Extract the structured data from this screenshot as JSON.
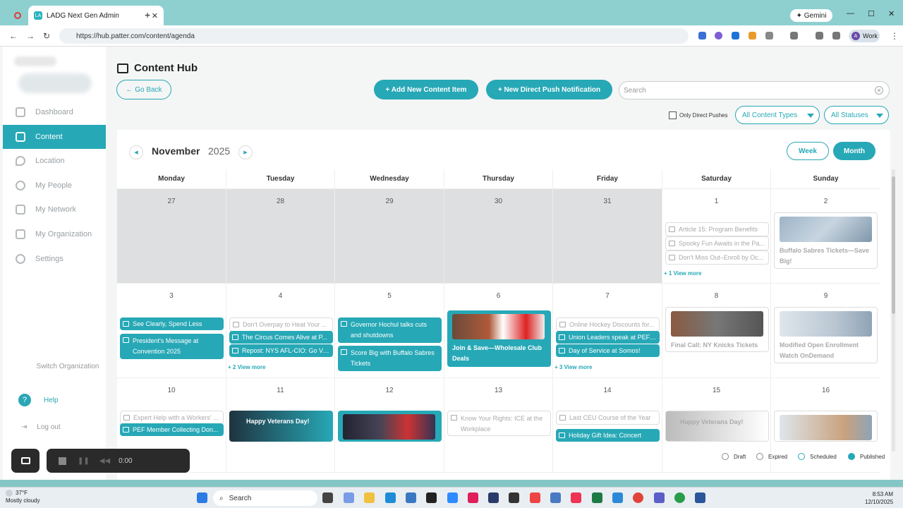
{
  "browser": {
    "tab_title": "LADG Next Gen Admin",
    "tab_favicon": "LA",
    "close_glyph": "✕",
    "new_tab_glyph": "+",
    "gemini_label": "✦ Gemini",
    "minimize_glyph": "—",
    "maximize_glyph": "☐",
    "window_close_glyph": "✕",
    "back_glyph": "←",
    "forward_glyph": "→",
    "reload_glyph": "↻",
    "url": "https://hub.patter.com/content/agenda",
    "profile_initial": "A",
    "profile_label": "Work",
    "menu_glyph": "⋮"
  },
  "sidebar": {
    "items": [
      {
        "label": "Dashboard",
        "active": false
      },
      {
        "label": "Content",
        "active": true
      },
      {
        "label": "Location",
        "active": false
      },
      {
        "label": "My People",
        "active": false
      },
      {
        "label": "My Network",
        "active": false
      },
      {
        "label": "My Organization",
        "active": false
      },
      {
        "label": "Settings",
        "active": false
      }
    ],
    "switch_label": "Switch Organization",
    "help_label": "Help",
    "help_glyph": "?",
    "logout_label": "Log out"
  },
  "header": {
    "title": "Content Hub",
    "go_back": "← Go Back",
    "add_content": "+ Add New Content Item",
    "new_push": "+ New Direct Push Notification",
    "search_placeholder": "Search",
    "search_clear_glyph": "✕",
    "only_direct_pushes": "Only Direct Pushes",
    "content_types": "All Content Types",
    "statuses": "All Statuses"
  },
  "calendar": {
    "month": "November",
    "year": "2025",
    "prev_glyph": "◀",
    "next_glyph": "▶",
    "week_label": "Week",
    "month_label": "Month",
    "days_of_week": [
      "Monday",
      "Tuesday",
      "Wednesday",
      "Thursday",
      "Friday",
      "Saturday",
      "Sunday"
    ],
    "weeks": [
      {
        "dates": [
          "27",
          "28",
          "29",
          "30",
          "31",
          "1",
          "2"
        ]
      },
      {
        "dates": [
          "3",
          "4",
          "5",
          "6",
          "7",
          "8",
          "9"
        ]
      },
      {
        "dates": [
          "10",
          "11",
          "12",
          "13",
          "14",
          "15",
          "16"
        ]
      }
    ],
    "events": {
      "sat1": [
        "Article 15: Program Benefits",
        "Spooky Fun Awaits in the Pa...",
        "Don't Miss Out–Enroll by Oc..."
      ],
      "sat1_more": "+ 1 View more",
      "sun2": "Buffalo Sabres Tickets—Save Big!",
      "mon3": [
        "See Clearly, Spend Less",
        "President's Message at Convention 2025"
      ],
      "tue4": [
        "Don't Overpay to Heat Your ...",
        "The Circus Comes Alive at P...",
        "Repost: NYS AFL-CIO: Go Vo..."
      ],
      "tue4_more": "+ 2 View more",
      "wed5": [
        "Governor Hochul talks cuts and shutdowns",
        "Score Big with Buffalo Sabres Tickets"
      ],
      "thu6": "Join & Save—Wholesale Club Deals",
      "fri7": [
        "Online Hockey Discounts for...",
        "Union Leaders speak at PEF ...",
        "Day of Service at Somos!"
      ],
      "fri7_more": "+ 3 View more",
      "sat8": "Final Call: NY Knicks Tickets",
      "sun9": "Modified Open Enrollment Watch OnDemand",
      "mon10": [
        "Expert Help with a Workers' ...",
        "PEF Member Collecting Don..."
      ],
      "tue11": "Happy Veterans Day!",
      "thu13": "Know Your Rights: ICE at the Workplace",
      "fri14": [
        "Last CEU Course of the Year",
        "Holiday Gift Idea: Concert"
      ],
      "sat15": "Happy Veterans Day!"
    }
  },
  "legend": [
    "Draft",
    "Expired",
    "Scheduled",
    "Published"
  ],
  "recorder": {
    "time": "0:00"
  },
  "taskbar": {
    "temp": "37°F",
    "weather": "Mostly cloudy",
    "search": "Search",
    "time": "8:53 AM",
    "date": "12/10/2025"
  },
  "colors": {
    "accent": "#27a8b6",
    "grey_cell": "#dddfe0"
  }
}
